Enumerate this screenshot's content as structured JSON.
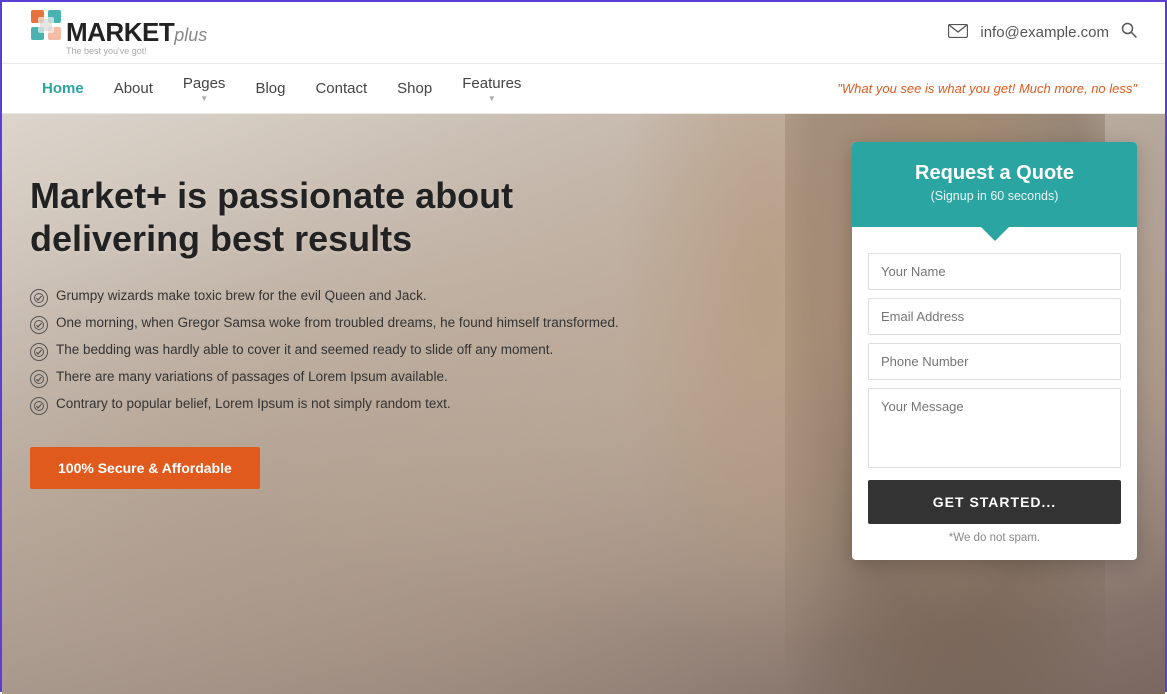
{
  "topbar": {
    "logo_main": "MARKET",
    "logo_sub": "plus",
    "logo_tagline": "The best you've got!",
    "email": "info@example.com",
    "search_aria": "Search"
  },
  "nav": {
    "items": [
      {
        "label": "Home",
        "active": true,
        "has_arrow": false
      },
      {
        "label": "About",
        "active": false,
        "has_arrow": false
      },
      {
        "label": "Pages",
        "active": false,
        "has_arrow": true
      },
      {
        "label": "Blog",
        "active": false,
        "has_arrow": false
      },
      {
        "label": "Contact",
        "active": false,
        "has_arrow": false
      },
      {
        "label": "Shop",
        "active": false,
        "has_arrow": false
      },
      {
        "label": "Features",
        "active": false,
        "has_arrow": true
      }
    ],
    "tagline": "\"What you see is what you get! Much more, no less\""
  },
  "hero": {
    "title": "Market+ is passionate about delivering best results",
    "bullets": [
      "Grumpy wizards make toxic brew for the evil Queen and Jack.",
      "One morning, when Gregor Samsa woke from troubled dreams, he found himself transformed.",
      "The bedding was hardly able to cover it and seemed ready to slide off any moment.",
      "There are many variations of passages of Lorem Ipsum available.",
      "Contrary to popular belief, Lorem Ipsum is not simply random text."
    ],
    "cta_label": "100% Secure & Affordable"
  },
  "quote_form": {
    "title": "Request a Quote",
    "subtitle": "(Signup in 60 seconds)",
    "name_placeholder": "Your Name",
    "email_placeholder": "Email Address",
    "phone_placeholder": "Phone Number",
    "message_placeholder": "Your Message",
    "submit_label": "GET STARTED...",
    "nospam": "*We do not spam."
  }
}
